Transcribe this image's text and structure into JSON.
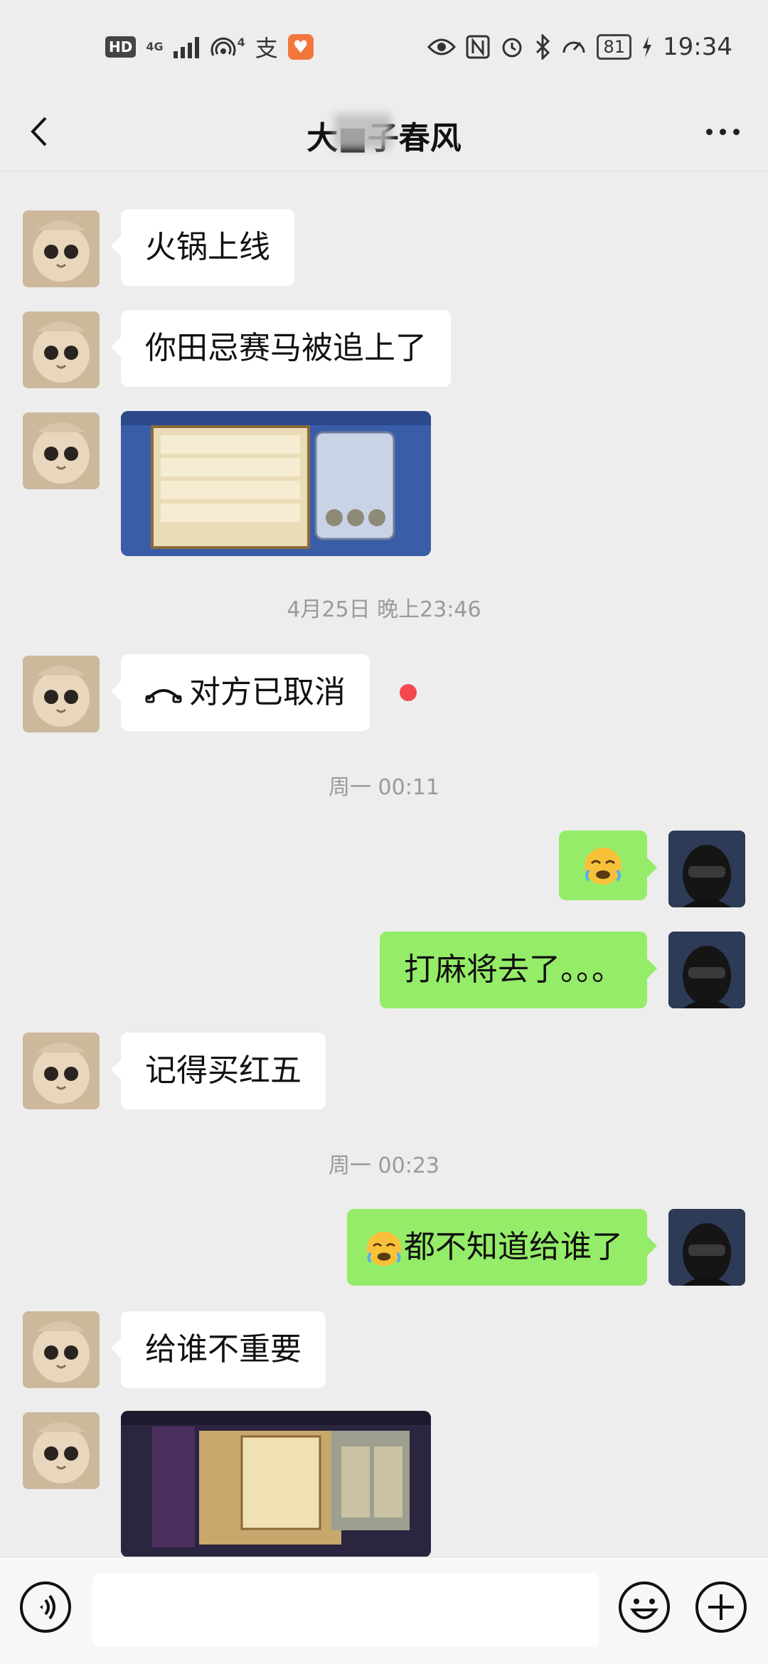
{
  "status_bar": {
    "hd": "HD",
    "network": "4G",
    "hotspot_count": "4",
    "alipay_icon": "支",
    "battery": "81",
    "time": "19:34"
  },
  "header": {
    "title": "大■子春风"
  },
  "messages": {
    "m1": "火锅上线",
    "m2": "你田忌赛马被追上了",
    "ts1": "4月25日 晚上23:46",
    "m3": "对方已取消",
    "ts2": "周一 00:11",
    "m5": "打麻将去了。。。",
    "m6": "记得买红五",
    "ts3": "周一 00:23",
    "m7": "都不知道给谁了",
    "m8": "给谁不重要"
  },
  "colors": {
    "background": "#ededed",
    "outgoing_bubble": "#95ec69",
    "incoming_bubble": "#ffffff",
    "unread_dot": "#f4484d"
  },
  "icons": [
    "back-icon",
    "more-icon",
    "phone-hangup-icon",
    "facepalm-emoji",
    "voice-icon",
    "emoji-icon",
    "plus-icon"
  ]
}
